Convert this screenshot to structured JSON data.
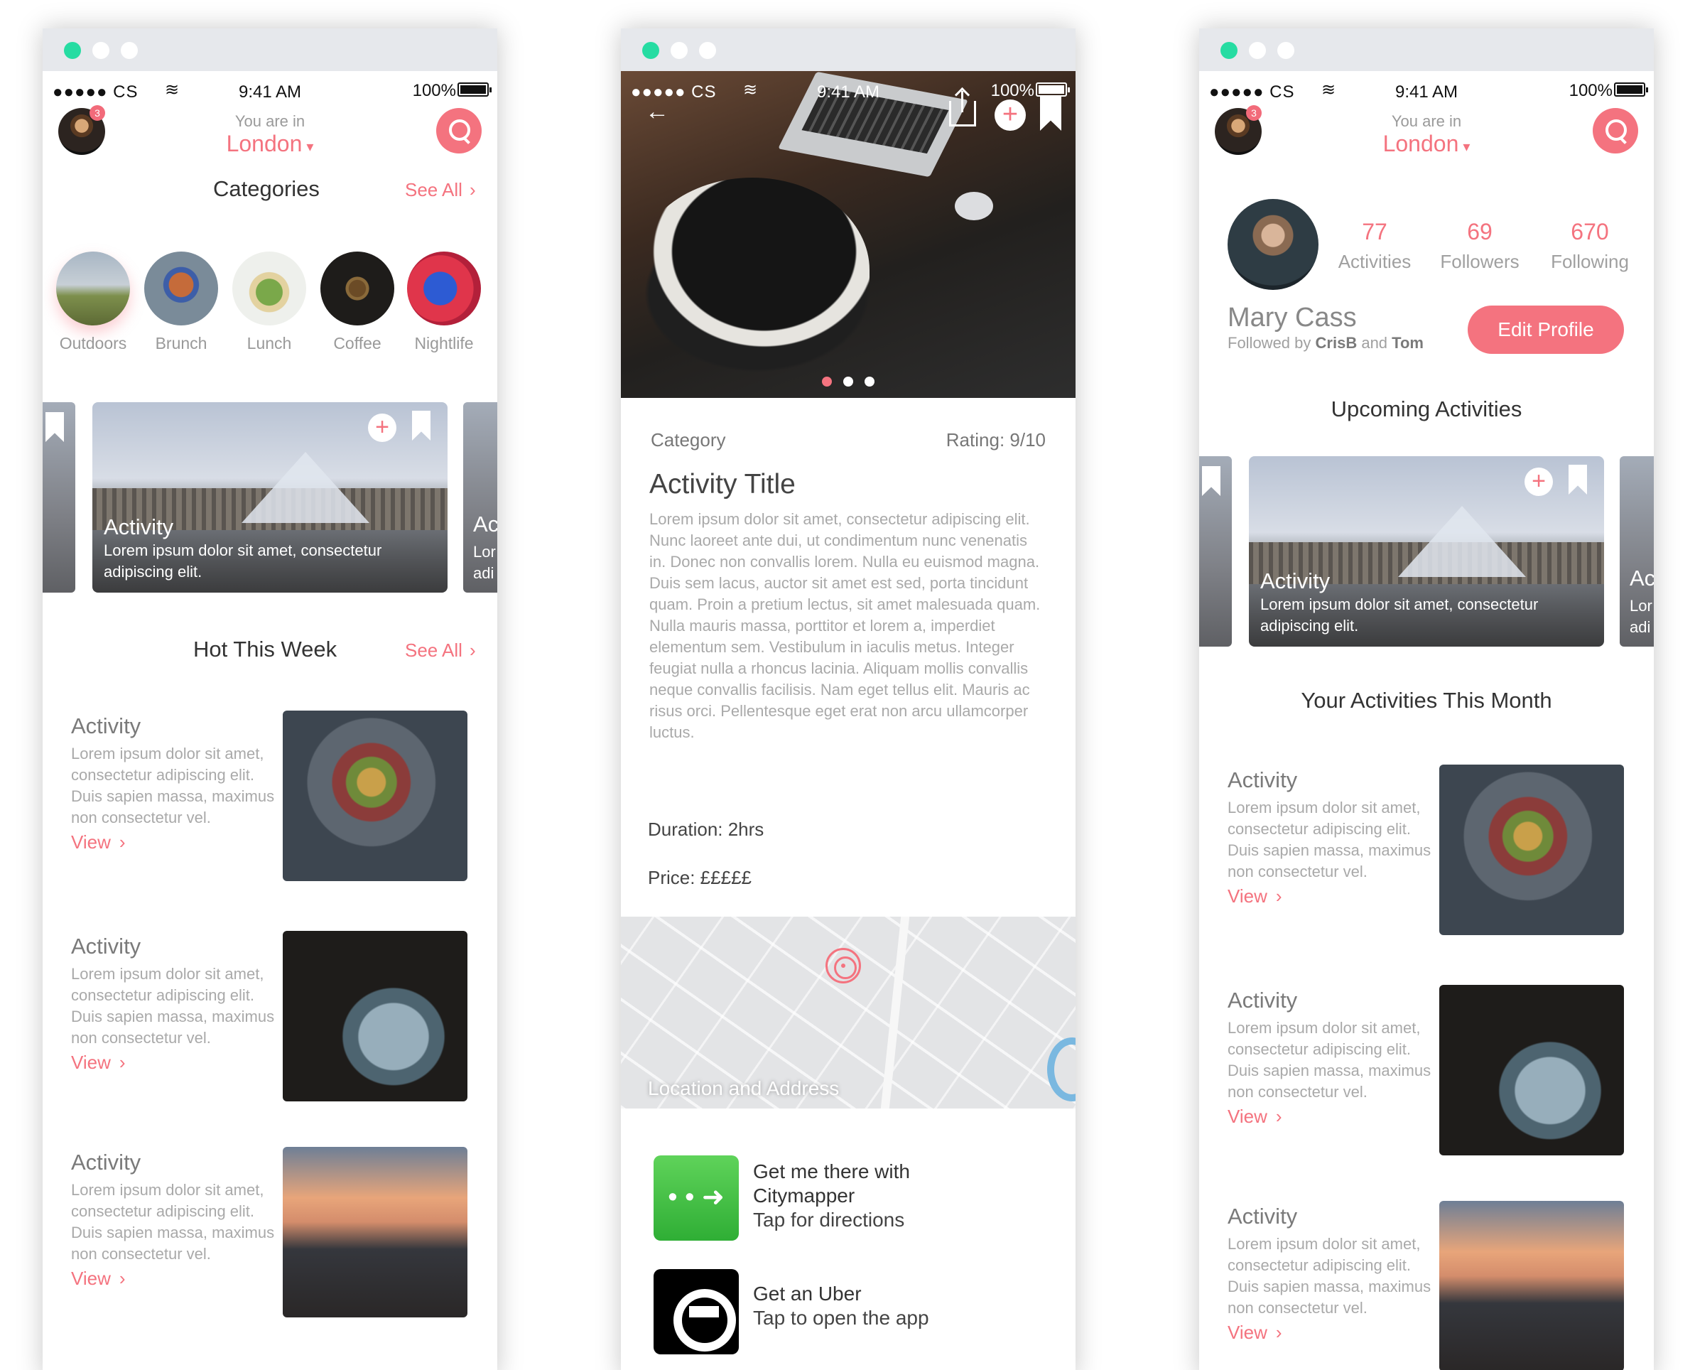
{
  "status": {
    "carrier": "●●●●● CS",
    "time": "9:41 AM",
    "battery": "100%"
  },
  "location": {
    "label": "You are in",
    "city": "London"
  },
  "notifications": "3",
  "categories": {
    "title": "Categories",
    "see_all": "See All",
    "items": [
      {
        "label": "Outdoors"
      },
      {
        "label": "Brunch"
      },
      {
        "label": "Lunch"
      },
      {
        "label": "Coffee"
      },
      {
        "label": "Nightlife"
      }
    ]
  },
  "featured": {
    "title": "Activity",
    "desc": "Lorem ipsum dolor sit amet, consectetur adipiscing elit.",
    "side_title": "Ac",
    "side_desc_1": "Lor",
    "side_desc_2": "adi"
  },
  "hot": {
    "title": "Hot This Week",
    "see_all": "See All",
    "items": [
      {
        "title": "Activity",
        "desc": "Lorem ipsum dolor sit amet, consectetur adipiscing elit. Duis sapien massa, maximus non consectetur vel.",
        "cta": "View"
      },
      {
        "title": "Activity",
        "desc": "Lorem ipsum dolor sit amet, consectetur adipiscing elit. Duis sapien massa, maximus non consectetur vel.",
        "cta": "View"
      },
      {
        "title": "Activity",
        "desc": "Lorem ipsum dolor sit amet, consectetur adipiscing elit. Duis sapien massa, maximus non consectetur vel.",
        "cta": "View"
      }
    ]
  },
  "detail": {
    "category": "Category",
    "rating": "Rating: 9/10",
    "title": "Activity Title",
    "description": "Lorem ipsum dolor sit amet, consectetur adipiscing elit. Nunc laoreet ante dui, ut condimentum nunc venenatis in. Donec non convallis lorem. Nulla eu euismod magna. Duis sem lacus, auctor sit amet est sed, porta tincidunt quam. Proin a pretium lectus, sit amet malesuada quam. Nulla mauris massa, porttitor et lorem a, imperdiet elementum sem. Vestibulum in iaculis metus. Integer feugiat nulla a rhoncus lacinia. Aliquam mollis convallis neque convallis facilisis. Nam eget tellus elit. Mauris ac risus orci. Pellentesque eget erat non arcu ullamcorper luctus.",
    "duration": "Duration: 2hrs",
    "price": "Price: £££££",
    "map_label": "Location and Address",
    "citymapper_line1": "Get me there with",
    "citymapper_line2": "Citymapper",
    "citymapper_sub": "Tap for directions",
    "uber_title": "Get an Uber",
    "uber_sub": "Tap to open the app"
  },
  "profile": {
    "stats": [
      {
        "value": "77",
        "label": "Activities"
      },
      {
        "value": "69",
        "label": "Followers"
      },
      {
        "value": "670",
        "label": "Following"
      }
    ],
    "name": "Mary Cass",
    "followed_prefix": "Followed by",
    "followed_a": "CrisB",
    "followed_and": "and",
    "followed_b": "Tom",
    "edit_label": "Edit Profile",
    "upcoming_title": "Upcoming Activities",
    "month_title": "Your Activities This Month"
  },
  "icons": {
    "back": "←",
    "plus": "+",
    "chevron": "›",
    "caret": "▾",
    "wifi": "≋"
  },
  "colors": {
    "accent": "#f4737f",
    "window_dot_active": "#26dca2"
  }
}
